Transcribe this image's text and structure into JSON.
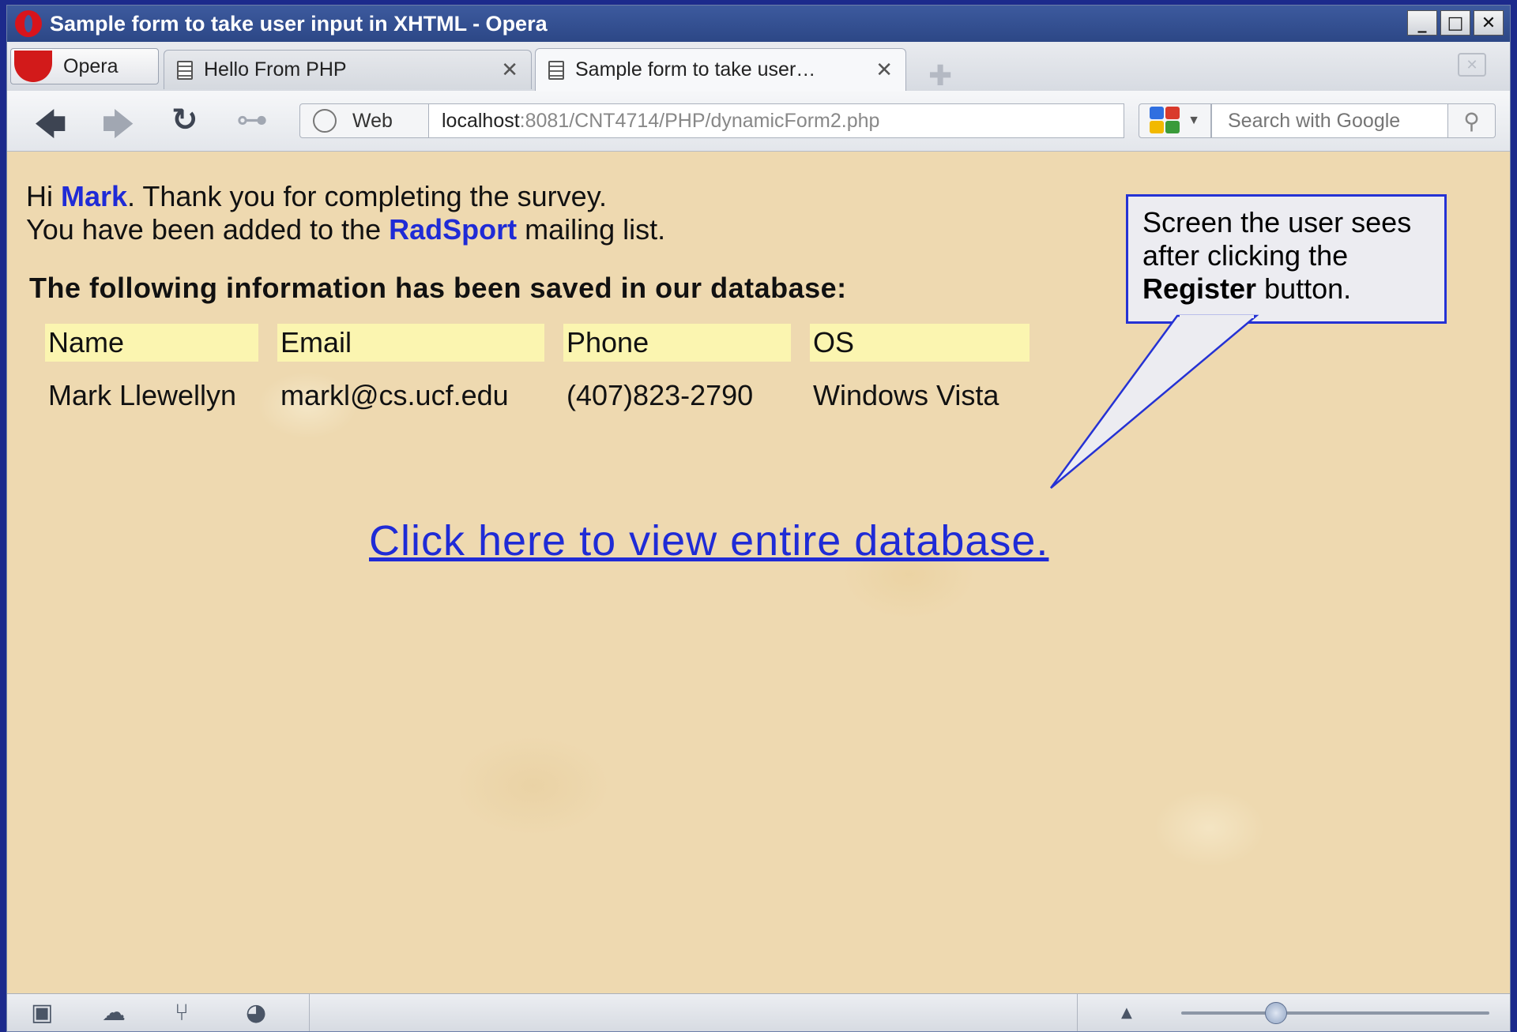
{
  "window": {
    "title": "Sample form to take user input in XHTML - Opera",
    "controls": {
      "minimize": "_",
      "maximize": "□",
      "close": "✕"
    }
  },
  "tabs": {
    "menu_label": "Opera",
    "items": [
      {
        "label": "Hello From PHP",
        "active": false,
        "close": "✕"
      },
      {
        "label": "Sample form to take user…",
        "active": true,
        "close": "✕"
      }
    ],
    "new_tab": "✚"
  },
  "nav": {
    "back": "🡄",
    "forward": "🡆",
    "reload": "↻",
    "key": "⊶",
    "web_label": "Web",
    "address_host": "localhost",
    "address_rest": ":8081/CNT4714/PHP/dynamicForm2.php",
    "search_placeholder": "Search with Google",
    "search_icon": "⚲"
  },
  "page": {
    "greeting_hi": "Hi ",
    "greeting_name": "Mark",
    "greeting_thanks": ". Thank you for completing the survey.",
    "added_prefix": "You have been added to the ",
    "added_list": "RadSport",
    "added_suffix": " mailing list.",
    "saved_heading": "The following information has been saved in our database:",
    "table": {
      "headers": [
        "Name",
        "Email",
        "Phone",
        "OS"
      ],
      "row": [
        "Mark Llewellyn",
        "markl@cs.ucf.edu",
        "(407)823-2790",
        "Windows Vista"
      ]
    },
    "db_link": "Click here to view entire database."
  },
  "callout": {
    "line1": "Screen the user sees after clicking the ",
    "bold": "Register",
    "line2": " button."
  },
  "status": {
    "icons": [
      "panel-toggle-icon",
      "cloud-icon",
      "share-icon",
      "speed-dial-icon"
    ],
    "scroll_up": "▲"
  },
  "colors": {
    "title_bar": "#2c4786",
    "link": "#1f2bd6",
    "page_bg": "#eed9b0",
    "table_header": "#fbf5b0",
    "callout_border": "#2532d4"
  }
}
